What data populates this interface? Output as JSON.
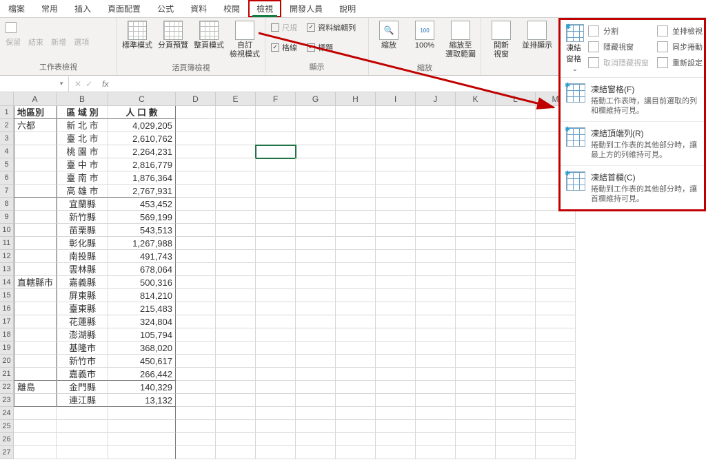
{
  "tabs": [
    "檔案",
    "常用",
    "插入",
    "頁面配置",
    "公式",
    "資料",
    "校閱",
    "檢視",
    "開發人員",
    "說明"
  ],
  "active_tab_index": 7,
  "ribbon": {
    "group1": {
      "items": [
        "保留",
        "結束",
        "新增",
        "選項"
      ],
      "label": "工作表檢視"
    },
    "group2": {
      "btns": [
        "標準模式",
        "分頁預覽",
        "整頁模式",
        "自訂\n檢視模式"
      ],
      "label": "活頁簿檢視"
    },
    "group3": {
      "chk1": "尺規",
      "chk2": "資料編輯列",
      "chk3": "格線",
      "chk4": "標題",
      "label": "顯示"
    },
    "group4": {
      "btns": [
        "縮放",
        "100%",
        "縮放至\n選取範圍"
      ],
      "label": "縮放"
    },
    "group5": {
      "btns": [
        "開新\n視窗",
        "並排顯示",
        "凍結窗格"
      ],
      "split": "分割",
      "hide": "隱藏視窗",
      "unhide": "取消隱藏視窗",
      "sr1": "並排檢視",
      "sr2": "同步捲動",
      "sr3": "重新設定"
    }
  },
  "freeze": {
    "items": [
      {
        "t": "凍結窗格(F)",
        "d": "捲動工作表時，讓目前選取的列和欄維持可見。"
      },
      {
        "t": "凍結頂端列(R)",
        "d": "捲動到工作表的其他部分時，讓最上方的列維持可見。"
      },
      {
        "t": "凍結首欄(C)",
        "d": "捲動到工作表的其他部分時，讓首欄維持可見。"
      }
    ]
  },
  "columns": [
    "A",
    "B",
    "C",
    "D",
    "E",
    "F",
    "G",
    "H",
    "I",
    "J",
    "K",
    "L",
    "M"
  ],
  "headers": {
    "a": "地區別",
    "b": "區  域  別",
    "c": "人    口    數"
  },
  "regions": {
    "r1": "六都",
    "r2": "直轄縣市",
    "r3": "離島"
  },
  "data": [
    {
      "b": "新 北 市",
      "c": "4,029,205"
    },
    {
      "b": "臺 北 市",
      "c": "2,610,762"
    },
    {
      "b": "桃 園 市",
      "c": "2,264,231"
    },
    {
      "b": "臺 中 市",
      "c": "2,816,779"
    },
    {
      "b": "臺 南 市",
      "c": "1,876,364"
    },
    {
      "b": "高 雄 市",
      "c": "2,767,931"
    },
    {
      "b": "宜蘭縣",
      "c": "453,452"
    },
    {
      "b": "新竹縣",
      "c": "569,199"
    },
    {
      "b": "苗栗縣",
      "c": "543,513"
    },
    {
      "b": "彰化縣",
      "c": "1,267,988"
    },
    {
      "b": "南投縣",
      "c": "491,743"
    },
    {
      "b": "雲林縣",
      "c": "678,064"
    },
    {
      "b": "嘉義縣",
      "c": "500,316"
    },
    {
      "b": "屏東縣",
      "c": "814,210"
    },
    {
      "b": "臺東縣",
      "c": "215,483"
    },
    {
      "b": "花蓮縣",
      "c": "324,804"
    },
    {
      "b": "澎湖縣",
      "c": "105,794"
    },
    {
      "b": "基隆市",
      "c": "368,020"
    },
    {
      "b": "新竹市",
      "c": "450,617"
    },
    {
      "b": "嘉義市",
      "c": "266,442"
    },
    {
      "b": "金門縣",
      "c": "140,329"
    },
    {
      "b": "連江縣",
      "c": "13,132"
    }
  ],
  "chart_data": {
    "type": "table",
    "title": "",
    "columns": [
      "地區別",
      "區域別",
      "人口數"
    ],
    "rows": [
      [
        "六都",
        "新北市",
        4029205
      ],
      [
        "六都",
        "臺北市",
        2610762
      ],
      [
        "六都",
        "桃園市",
        2264231
      ],
      [
        "六都",
        "臺中市",
        2816779
      ],
      [
        "六都",
        "臺南市",
        1876364
      ],
      [
        "六都",
        "高雄市",
        2767931
      ],
      [
        "直轄縣市",
        "宜蘭縣",
        453452
      ],
      [
        "直轄縣市",
        "新竹縣",
        569199
      ],
      [
        "直轄縣市",
        "苗栗縣",
        543513
      ],
      [
        "直轄縣市",
        "彰化縣",
        1267988
      ],
      [
        "直轄縣市",
        "南投縣",
        491743
      ],
      [
        "直轄縣市",
        "雲林縣",
        678064
      ],
      [
        "直轄縣市",
        "嘉義縣",
        500316
      ],
      [
        "直轄縣市",
        "屏東縣",
        814210
      ],
      [
        "直轄縣市",
        "臺東縣",
        215483
      ],
      [
        "直轄縣市",
        "花蓮縣",
        324804
      ],
      [
        "直轄縣市",
        "澎湖縣",
        105794
      ],
      [
        "直轄縣市",
        "基隆市",
        368020
      ],
      [
        "直轄縣市",
        "新竹市",
        450617
      ],
      [
        "直轄縣市",
        "嘉義市",
        266442
      ],
      [
        "離島",
        "金門縣",
        140329
      ],
      [
        "離島",
        "連江縣",
        13132
      ]
    ]
  }
}
